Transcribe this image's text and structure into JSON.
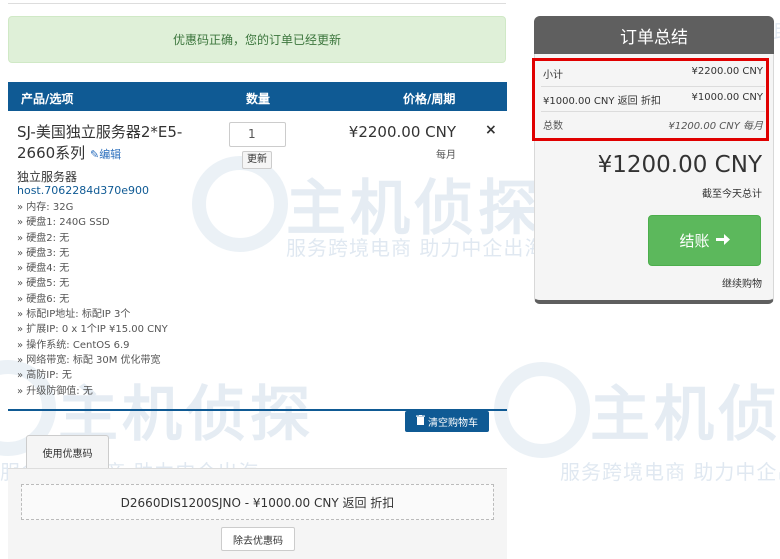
{
  "watermark": {
    "logo_text": "主机侦探",
    "tagline": "服务跨境电商 助力中企出海"
  },
  "alert": {
    "message": "优惠码正确，您的订单已经更新"
  },
  "cart_table": {
    "headers": {
      "product": "产品/选项",
      "qty": "数量",
      "price": "价格/周期"
    }
  },
  "item": {
    "name": "SJ-美国独立服务器2*E5-2660系列",
    "edit_label": "编辑",
    "group": "独立服务器",
    "host": "host.7062284d370e900",
    "options": [
      "» 内存: 32G",
      "» 硬盘1: 240G SSD",
      "» 硬盘2: 无",
      "» 硬盘3: 无",
      "» 硬盘4: 无",
      "» 硬盘5: 无",
      "» 硬盘6: 无",
      "» 标配IP地址: 标配IP 3个",
      "» 扩展IP: 0 x 1个IP ¥15.00 CNY",
      "» 操作系统: CentOS 6.9",
      "» 网络带宽: 标配 30M 优化带宽",
      "» 高防IP: 无",
      "» 升级防御值: 无"
    ],
    "quantity": "1",
    "update_label": "更新",
    "price": "¥2200.00 CNY",
    "cycle": "每月",
    "remove_symbol": "×"
  },
  "empty_cart_label": "清空购物车",
  "promo": {
    "tab_label": "使用优惠码",
    "applied_text": "D2660DIS1200SJNO - ¥1000.00 CNY 返回 折扣",
    "remove_label": "除去优惠码"
  },
  "summary": {
    "title": "订单总结",
    "rows": [
      {
        "label": "小计",
        "value": "¥2200.00 CNY"
      },
      {
        "label": "¥1000.00 CNY 返回 折扣",
        "value": "¥1000.00 CNY"
      },
      {
        "label": "总数",
        "value": "¥1200.00 CNY 每月"
      }
    ],
    "total_due": "¥1200.00 CNY",
    "due_today_label": "截至今天总计",
    "checkout_label": "结账",
    "continue_label": "继续购物"
  },
  "colors": {
    "primary_blue": "#0f5a94",
    "success_green": "#5cb85c",
    "alert_bg": "#dff0d8",
    "highlight_red": "#e00000",
    "summary_header": "#5f5f5f"
  }
}
